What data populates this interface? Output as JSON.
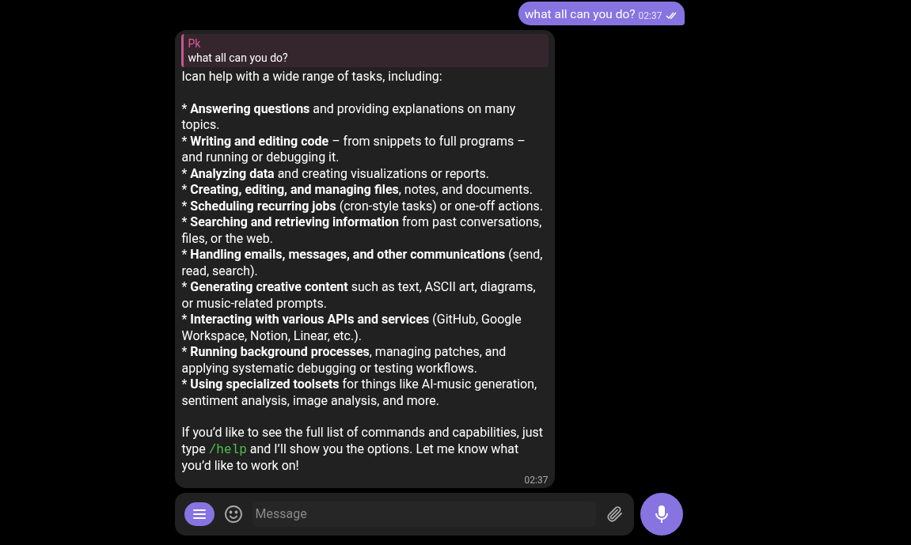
{
  "outgoing": {
    "text": "what all can you do?",
    "time": "02:37",
    "read": true
  },
  "reply": {
    "quote": {
      "author": "Pk",
      "text": "what all can you do?"
    },
    "intro": "Ican help with a wide range of tasks, including:",
    "items": [
      "* **Answering questions** and providing explanations on many topics.",
      "* **Writing and editing code** – from snippets to full programs – and running or debugging it.",
      "* **Analyzing data** and creating visualizations or reports.",
      "* **Creating, editing, and managing files**, notes, and documents.",
      "* **Scheduling recurring jobs** (cron-style tasks) or one-off actions.",
      "* **Searching and retrieving information** from past conversations, files, or the web.",
      "* **Handling emails, messages, and other communications** (send, read, search).",
      "* **Generating creative content** such as text, ASCII art, diagrams, or music-related prompts.",
      "* **Interacting with various APIs and services** (GitHub, Google Workspace, Notion, Linear, etc.).",
      "* **Running background processes**, managing patches, and applying systematic debugging or testing workflows.",
      "* **Using specialized toolsets** for things like AI-music generation, sentiment analysis, image analysis, and more."
    ],
    "closing_before": "If you’d like to see the full list of commands and capabilities, just type",
    "closing_code": "/help",
    "closing_after": "and I’ll show you the options. Let me know what you’d like to work on!",
    "time": "02:37"
  },
  "composer": {
    "placeholder": "Message"
  }
}
